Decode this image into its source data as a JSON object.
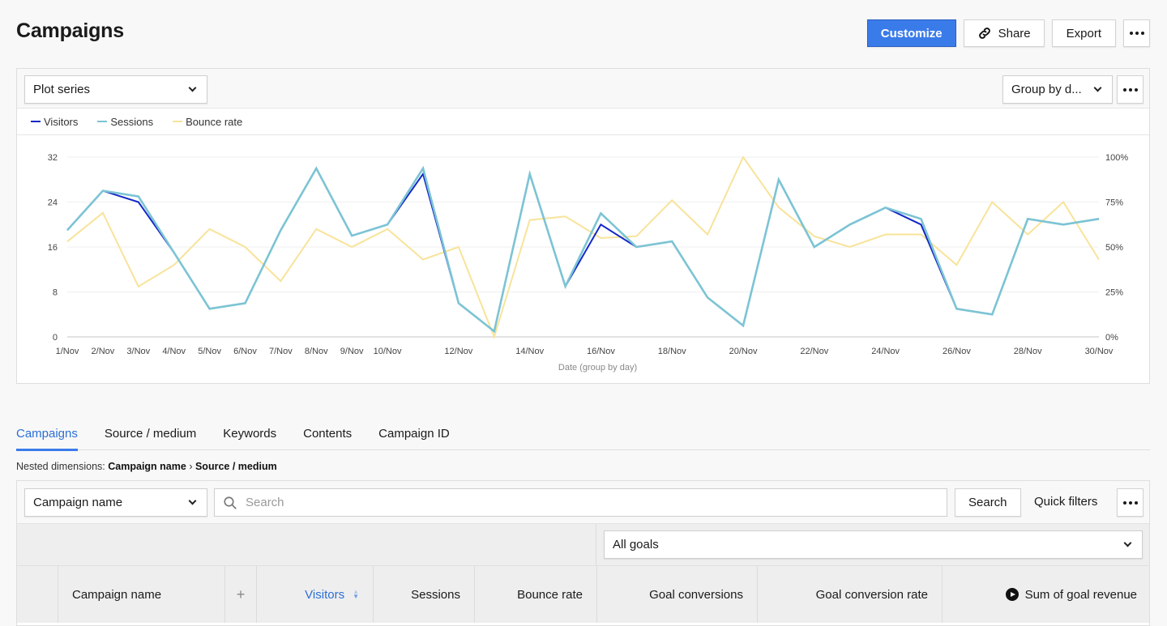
{
  "header": {
    "title": "Campaigns",
    "customize_label": "Customize",
    "share_label": "Share",
    "export_label": "Export"
  },
  "chart_toolbar": {
    "plot_series_label": "Plot series",
    "group_by_label": "Group by d..."
  },
  "chart_data": {
    "type": "line",
    "title": "",
    "xlabel": "Date (group by day)",
    "ylabel": "",
    "ylim": [
      0,
      32
    ],
    "y_ticks": [
      "0",
      "8",
      "16",
      "24",
      "32"
    ],
    "y2lim": [
      0,
      100
    ],
    "y2_ticks": [
      "0%",
      "25%",
      "50%",
      "75%",
      "100%"
    ],
    "grid": true,
    "legend_position": "top-left",
    "x": [
      "1/Nov",
      "2/Nov",
      "3/Nov",
      "4/Nov",
      "5/Nov",
      "6/Nov",
      "7/Nov",
      "8/Nov",
      "9/Nov",
      "10/Nov",
      "11/Nov",
      "12/Nov",
      "13/Nov",
      "14/Nov",
      "15/Nov",
      "16/Nov",
      "17/Nov",
      "18/Nov",
      "19/Nov",
      "20/Nov",
      "21/Nov",
      "22/Nov",
      "23/Nov",
      "24/Nov",
      "25/Nov",
      "26/Nov",
      "27/Nov",
      "28/Nov",
      "29/Nov",
      "30/Nov"
    ],
    "x_tick_labels": [
      "1/Nov",
      "2/Nov",
      "3/Nov",
      "4/Nov",
      "5/Nov",
      "6/Nov",
      "7/Nov",
      "8/Nov",
      "9/Nov",
      "10/Nov",
      "",
      "12/Nov",
      "",
      "14/Nov",
      "",
      "16/Nov",
      "",
      "18/Nov",
      "",
      "20/Nov",
      "",
      "22/Nov",
      "",
      "24/Nov",
      "",
      "26/Nov",
      "",
      "28/Nov",
      "",
      "30/Nov"
    ],
    "series": [
      {
        "name": "Visitors",
        "color": "#1428c8",
        "axis": "left",
        "values": [
          19,
          26,
          24,
          15,
          5,
          6,
          19,
          30,
          18,
          20,
          29,
          6,
          1,
          29,
          9,
          20,
          16,
          17,
          7,
          2,
          28,
          16,
          20,
          23,
          20,
          5,
          4,
          21,
          20,
          21
        ]
      },
      {
        "name": "Sessions",
        "color": "#7cc4d4",
        "axis": "left",
        "values": [
          19,
          26,
          25,
          15,
          5,
          6,
          19,
          30,
          18,
          20,
          30,
          6,
          1,
          29,
          9,
          22,
          16,
          17,
          7,
          2,
          28,
          16,
          20,
          23,
          21,
          5,
          4,
          21,
          20,
          21
        ]
      },
      {
        "name": "Bounce rate",
        "color": "#f8e39a",
        "axis": "right",
        "values": [
          53,
          69,
          28,
          40,
          60,
          50,
          31,
          60,
          50,
          60,
          43,
          50,
          0,
          65,
          67,
          55,
          56,
          76,
          57,
          100,
          72,
          56,
          50,
          57,
          57,
          40,
          75,
          57,
          75,
          43
        ]
      }
    ]
  },
  "tabs": [
    {
      "label": "Campaigns",
      "active": true
    },
    {
      "label": "Source / medium",
      "active": false
    },
    {
      "label": "Keywords",
      "active": false
    },
    {
      "label": "Contents",
      "active": false
    },
    {
      "label": "Campaign ID",
      "active": false
    }
  ],
  "nested": {
    "prefix": "Nested dimensions:",
    "first": "Campaign name",
    "separator": "›",
    "second": "Source / medium"
  },
  "table_toolbar": {
    "dimension_select": "Campaign name",
    "search_placeholder": "Search",
    "search_value": "",
    "search_button": "Search",
    "quick_filters": "Quick filters",
    "goals_select": "All goals"
  },
  "columns": [
    {
      "label": "Campaign name"
    },
    {
      "label": "+"
    },
    {
      "label": "Visitors",
      "sorted": true
    },
    {
      "label": "Sessions"
    },
    {
      "label": "Bounce rate"
    },
    {
      "label": "Goal conversions"
    },
    {
      "label": "Goal conversion rate"
    },
    {
      "label": "Sum of goal revenue"
    }
  ]
}
